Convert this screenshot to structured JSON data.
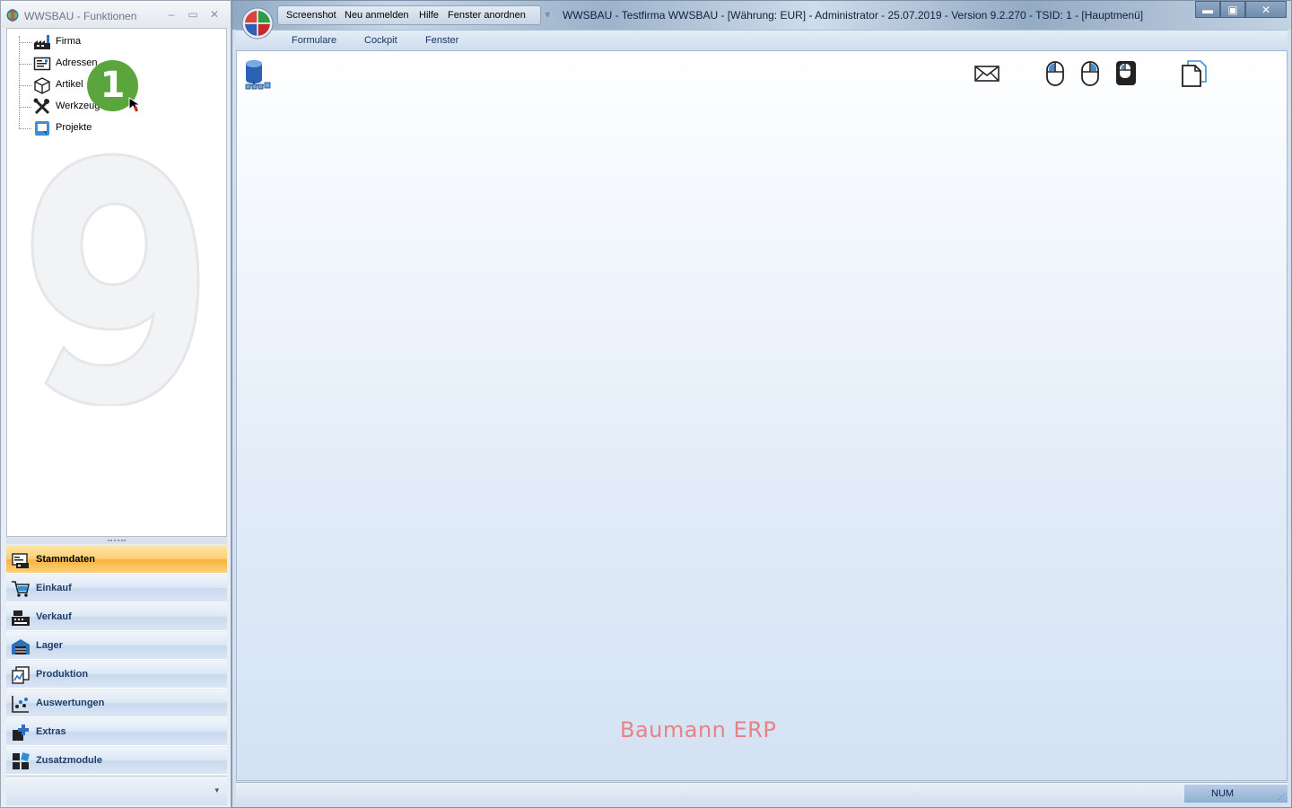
{
  "left_window": {
    "title": "WWSBAU - Funktionen",
    "controls": {
      "minimize": "–",
      "maximize": "▭",
      "close": "✕"
    },
    "tree": [
      {
        "label": "Firma",
        "icon": "factory-icon"
      },
      {
        "label": "Adressen",
        "icon": "address-card-icon"
      },
      {
        "label": "Artikel",
        "icon": "box-icon"
      },
      {
        "label": "Werkzeuge",
        "icon": "tools-icon"
      },
      {
        "label": "Projekte",
        "icon": "project-icon"
      }
    ],
    "badge": "1",
    "nav_groups": [
      {
        "label": "Stammdaten",
        "icon": "stammdaten-icon",
        "active": true
      },
      {
        "label": "Einkauf",
        "icon": "cart-icon",
        "active": false
      },
      {
        "label": "Verkauf",
        "icon": "cash-register-icon",
        "active": false
      },
      {
        "label": "Lager",
        "icon": "warehouse-icon",
        "active": false
      },
      {
        "label": "Produktion",
        "icon": "production-icon",
        "active": false
      },
      {
        "label": "Auswertungen",
        "icon": "analysis-icon",
        "active": false
      },
      {
        "label": "Extras",
        "icon": "extras-icon",
        "active": false
      },
      {
        "label": "Zusatzmodule",
        "icon": "modules-icon",
        "active": false
      }
    ],
    "footer_arrow": "▾"
  },
  "main_window": {
    "quick_access": [
      "Screenshot",
      "Neu anmelden",
      "Hilfe",
      "Fenster anordnen"
    ],
    "qat_dropdown": "▿",
    "title": "WWSBAU - Testfirma WWSBAU - [Währung: EUR] - Administrator - 25.07.2019 - Version 9.2.270 - TSID: 1  - [Hauptmenü]",
    "controls": {
      "minimize": "▬",
      "maximize": "▣",
      "close": "✕"
    },
    "menu": [
      "Formulare",
      "Cockpit",
      "Fenster"
    ],
    "toolbar_icons": [
      "mail-icon",
      "mouse-left-icon",
      "mouse-right-icon",
      "mouse-keyboard-icon",
      "document-copy-icon"
    ],
    "brand": "Baumann ERP",
    "status": {
      "num": "NUM",
      "grip": "⋰"
    }
  },
  "colors": {
    "active_group": "#f7b33d",
    "brand_text": "#e98285",
    "badge": "#5aa53c"
  }
}
